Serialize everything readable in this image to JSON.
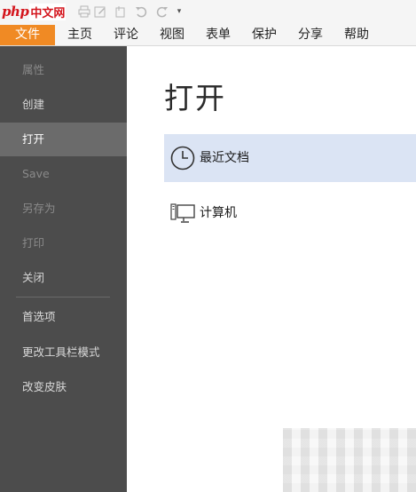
{
  "logo": {
    "brand": "php",
    "text": "中文网"
  },
  "quick_access": {
    "icons": [
      "new-file-icon",
      "open-folder-icon",
      "save-icon",
      "print-icon",
      "edit-icon",
      "attach-icon",
      "undo-icon",
      "redo-icon",
      "customize-dropdown-icon"
    ]
  },
  "tabs": [
    {
      "label": "文件",
      "active": true
    },
    {
      "label": "主页"
    },
    {
      "label": "评论"
    },
    {
      "label": "视图"
    },
    {
      "label": "表单"
    },
    {
      "label": "保护"
    },
    {
      "label": "分享"
    },
    {
      "label": "帮助"
    }
  ],
  "sidebar": {
    "items": [
      {
        "label": "属性",
        "state": "disabled"
      },
      {
        "label": "创建",
        "state": "normal"
      },
      {
        "label": "打开",
        "state": "active"
      },
      {
        "label": "Save",
        "state": "disabled"
      },
      {
        "label": "另存为",
        "state": "disabled"
      },
      {
        "label": "打印",
        "state": "disabled"
      },
      {
        "label": "关闭",
        "state": "normal"
      },
      {
        "label": "首选项",
        "state": "normal"
      },
      {
        "label": "更改工具栏模式",
        "state": "normal"
      },
      {
        "label": "改变皮肤",
        "state": "normal"
      }
    ]
  },
  "main": {
    "title": "打开",
    "places": [
      {
        "label": "最近文档",
        "icon": "clock-icon",
        "selected": true
      },
      {
        "label": "计算机",
        "icon": "computer-icon",
        "selected": false
      }
    ]
  },
  "colors": {
    "accent": "#f08a24",
    "sidebar_bg": "#4c4c4c",
    "sidebar_active": "#6b6b6b",
    "selected_bg": "#dbe4f4"
  }
}
